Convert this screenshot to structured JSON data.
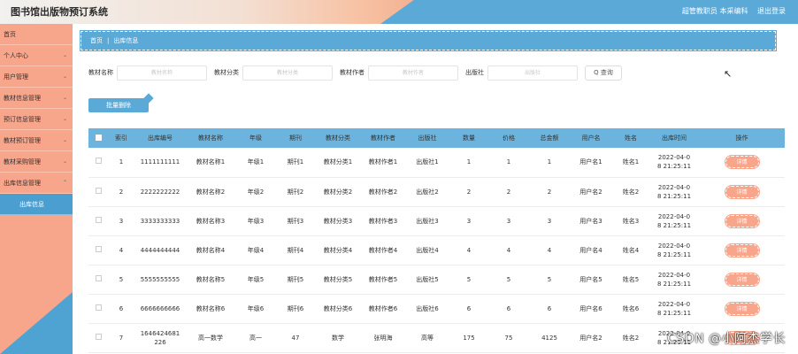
{
  "app": {
    "title": "图书馆出版物预订系统",
    "user_label": "超管教职员 本采编科",
    "logout_label": "退出登录"
  },
  "sidebar": {
    "items": [
      {
        "label": "首页",
        "has_chevron": false
      },
      {
        "label": "个人中心",
        "has_chevron": true
      },
      {
        "label": "用户管理",
        "has_chevron": true
      },
      {
        "label": "教材信息管理",
        "has_chevron": true
      },
      {
        "label": "预订信息管理",
        "has_chevron": true
      },
      {
        "label": "教材预订管理",
        "has_chevron": true
      },
      {
        "label": "教材采购管理",
        "has_chevron": true
      },
      {
        "label": "出库信息管理",
        "has_chevron": true
      }
    ],
    "subitem": {
      "label": "出库信息"
    }
  },
  "breadcrumb": {
    "home": "首页",
    "current": "出库信息"
  },
  "filters": {
    "name_label": "教材名称",
    "name_placeholder": "教材名称",
    "category_label": "教材分类",
    "category_placeholder": "教材分类",
    "author_label": "教材作者",
    "author_placeholder": "教材作者",
    "publisher_label": "出版社",
    "publisher_placeholder": "出版社",
    "search_label": "Q 查询"
  },
  "actions": {
    "delete_label": "批量删除"
  },
  "table": {
    "headers": [
      "",
      "索引",
      "出库编号",
      "教材名称",
      "年级",
      "期刊",
      "教材分类",
      "教材作者",
      "出版社",
      "数量",
      "价格",
      "总金额",
      "用户名",
      "姓名",
      "出库时间",
      "操作"
    ],
    "detail_label": "详情",
    "rows": [
      {
        "idx": "1",
        "no": "1111111111",
        "name": "教材名称1",
        "grade": "年级1",
        "journal": "期刊1",
        "cat": "教材分类1",
        "author": "教材作者1",
        "pub": "出版社1",
        "qty": "1",
        "price": "1",
        "total": "1",
        "user": "用户名1",
        "real": "姓名1",
        "time1": "2022-04-0",
        "time2": "8 21:25:11"
      },
      {
        "idx": "2",
        "no": "2222222222",
        "name": "教材名称2",
        "grade": "年级2",
        "journal": "期刊2",
        "cat": "教材分类2",
        "author": "教材作者2",
        "pub": "出版社2",
        "qty": "2",
        "price": "2",
        "total": "2",
        "user": "用户名2",
        "real": "姓名2",
        "time1": "2022-04-0",
        "time2": "8 21:25:11"
      },
      {
        "idx": "3",
        "no": "3333333333",
        "name": "教材名称3",
        "grade": "年级3",
        "journal": "期刊3",
        "cat": "教材分类3",
        "author": "教材作者3",
        "pub": "出版社3",
        "qty": "3",
        "price": "3",
        "total": "3",
        "user": "用户名3",
        "real": "姓名3",
        "time1": "2022-04-0",
        "time2": "8 21:25:11"
      },
      {
        "idx": "4",
        "no": "4444444444",
        "name": "教材名称4",
        "grade": "年级4",
        "journal": "期刊4",
        "cat": "教材分类4",
        "author": "教材作者4",
        "pub": "出版社4",
        "qty": "4",
        "price": "4",
        "total": "4",
        "user": "用户名4",
        "real": "姓名4",
        "time1": "2022-04-0",
        "time2": "8 21:25:11"
      },
      {
        "idx": "5",
        "no": "5555555555",
        "name": "教材名称5",
        "grade": "年级5",
        "journal": "期刊5",
        "cat": "教材分类5",
        "author": "教材作者5",
        "pub": "出版社5",
        "qty": "5",
        "price": "5",
        "total": "5",
        "user": "用户名5",
        "real": "姓名5",
        "time1": "2022-04-0",
        "time2": "8 21:25:11"
      },
      {
        "idx": "6",
        "no": "6666666666",
        "name": "教材名称6",
        "grade": "年级6",
        "journal": "期刊6",
        "cat": "教材分类6",
        "author": "教材作者6",
        "pub": "出版社6",
        "qty": "6",
        "price": "6",
        "total": "6",
        "user": "用户名6",
        "real": "姓名6",
        "time1": "2022-04-0",
        "time2": "8 21:25:11"
      },
      {
        "idx": "7",
        "no": "1646424681 226",
        "name": "高一数学",
        "grade": "高一",
        "journal": "47",
        "cat": "数学",
        "author": "张明海",
        "pub": "高等",
        "qty": "175",
        "price": "75",
        "total": "4125",
        "user": "用户名2",
        "real": "姓名2",
        "time1": "2022-04-0",
        "time2": "8 21:25:11"
      }
    ]
  },
  "watermark": "CSDN @小阿杰学长",
  "colors": {
    "salmon": "#f7a58b",
    "blue": "#5aa9d6",
    "header_blue": "#6cb4dd"
  }
}
